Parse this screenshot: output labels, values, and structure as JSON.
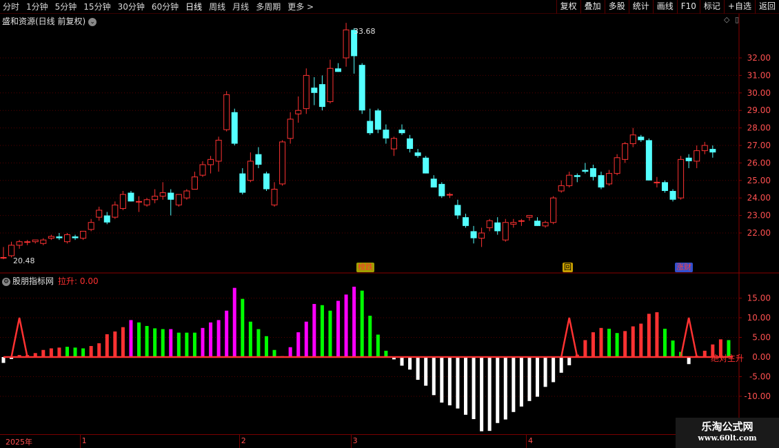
{
  "toolbar": {
    "periods": [
      "分时",
      "1分钟",
      "5分钟",
      "15分钟",
      "30分钟",
      "60分钟",
      "日线",
      "周线",
      "月线",
      "多周期",
      "更多 >"
    ],
    "active_period": "日线",
    "buttons": [
      "复权",
      "叠加",
      "多股",
      "统计",
      "画线",
      "F10",
      "标记",
      "+自选",
      "返回"
    ]
  },
  "stock": {
    "title": "盛和资源(日线 前复权)",
    "high_label": "33.68",
    "low_label": "20.48"
  },
  "indicator": {
    "name": "股朋指标网",
    "value_label": "拉升: 0.00",
    "absolute_label": "绝对主升"
  },
  "badges": {
    "bangdie": "榜跌",
    "hui": "回",
    "zhangcai": "涨财"
  },
  "price_axis": [
    "32.00",
    "31.00",
    "30.00",
    "29.00",
    "28.00",
    "27.00",
    "26.00",
    "25.00",
    "24.00",
    "23.00",
    "22.00"
  ],
  "indicator_axis": [
    "15.00",
    "10.00",
    "5.00",
    "0.00",
    "-5.00",
    "-10.00"
  ],
  "date_axis": [
    "2025年",
    "1",
    "2",
    "3",
    "4"
  ],
  "watermark": {
    "line1": "乐淘公式网",
    "line2": "www.60lt.com"
  },
  "colors": {
    "up": "#ff3232",
    "down": "#54ffff",
    "bg": "#000000",
    "grid": "#5a0000",
    "pink": "#ff00ff",
    "green": "#00ff00",
    "white": "#ffffff"
  },
  "chart_data": {
    "type": "candlestick",
    "title": "盛和资源(日线 前复权)",
    "ylim": [
      21.0,
      33.8
    ],
    "candles": [
      {
        "o": 20.6,
        "h": 21.2,
        "l": 20.5,
        "c": 20.6
      },
      {
        "o": 20.7,
        "h": 21.5,
        "l": 20.6,
        "c": 21.3
      },
      {
        "o": 21.3,
        "h": 21.6,
        "l": 21.1,
        "c": 21.5
      },
      {
        "o": 21.5,
        "h": 21.6,
        "l": 21.3,
        "c": 21.5
      },
      {
        "o": 21.5,
        "h": 21.6,
        "l": 21.4,
        "c": 21.6
      },
      {
        "o": 21.4,
        "h": 21.7,
        "l": 21.3,
        "c": 21.6
      },
      {
        "o": 21.7,
        "h": 21.9,
        "l": 21.6,
        "c": 21.8
      },
      {
        "o": 21.8,
        "h": 22.0,
        "l": 21.6,
        "c": 21.7
      },
      {
        "o": 21.5,
        "h": 22.0,
        "l": 21.4,
        "c": 21.9
      },
      {
        "o": 21.8,
        "h": 21.9,
        "l": 21.6,
        "c": 21.7
      },
      {
        "o": 21.7,
        "h": 22.1,
        "l": 21.6,
        "c": 22.1
      },
      {
        "o": 22.2,
        "h": 22.8,
        "l": 22.1,
        "c": 22.6
      },
      {
        "o": 22.9,
        "h": 23.5,
        "l": 22.7,
        "c": 23.3
      },
      {
        "o": 23.0,
        "h": 23.2,
        "l": 22.5,
        "c": 22.6
      },
      {
        "o": 22.9,
        "h": 23.8,
        "l": 22.8,
        "c": 23.6
      },
      {
        "o": 23.4,
        "h": 24.4,
        "l": 23.3,
        "c": 24.2
      },
      {
        "o": 24.3,
        "h": 24.4,
        "l": 23.8,
        "c": 23.8
      },
      {
        "o": 23.8,
        "h": 24.1,
        "l": 23.2,
        "c": 23.8
      },
      {
        "o": 23.6,
        "h": 24.0,
        "l": 23.5,
        "c": 23.9
      },
      {
        "o": 23.9,
        "h": 24.5,
        "l": 23.7,
        "c": 24.1
      },
      {
        "o": 24.1,
        "h": 24.9,
        "l": 23.9,
        "c": 24.3
      },
      {
        "o": 24.3,
        "h": 24.5,
        "l": 23.0,
        "c": 23.9
      },
      {
        "o": 23.6,
        "h": 24.2,
        "l": 23.5,
        "c": 24.2
      },
      {
        "o": 24.0,
        "h": 24.5,
        "l": 23.9,
        "c": 24.4
      },
      {
        "o": 24.5,
        "h": 25.5,
        "l": 24.5,
        "c": 25.2
      },
      {
        "o": 25.3,
        "h": 26.1,
        "l": 25.2,
        "c": 25.9
      },
      {
        "o": 25.9,
        "h": 26.4,
        "l": 25.4,
        "c": 26.2
      },
      {
        "o": 26.1,
        "h": 27.5,
        "l": 25.5,
        "c": 27.3
      },
      {
        "o": 27.9,
        "h": 30.1,
        "l": 27.8,
        "c": 29.9
      },
      {
        "o": 28.9,
        "h": 29.1,
        "l": 27.0,
        "c": 27.1
      },
      {
        "o": 25.4,
        "h": 25.7,
        "l": 24.2,
        "c": 24.3
      },
      {
        "o": 25.0,
        "h": 26.6,
        "l": 24.9,
        "c": 26.1
      },
      {
        "o": 26.5,
        "h": 26.9,
        "l": 25.7,
        "c": 25.9
      },
      {
        "o": 25.4,
        "h": 25.5,
        "l": 24.4,
        "c": 24.5
      },
      {
        "o": 23.6,
        "h": 24.9,
        "l": 23.5,
        "c": 24.5
      },
      {
        "o": 24.8,
        "h": 27.3,
        "l": 24.7,
        "c": 27.2
      },
      {
        "o": 27.4,
        "h": 28.9,
        "l": 27.1,
        "c": 28.5
      },
      {
        "o": 28.8,
        "h": 29.8,
        "l": 28.3,
        "c": 29.0
      },
      {
        "o": 29.1,
        "h": 31.4,
        "l": 28.8,
        "c": 31.0
      },
      {
        "o": 30.3,
        "h": 30.9,
        "l": 29.3,
        "c": 30.0
      },
      {
        "o": 30.5,
        "h": 31.0,
        "l": 29.0,
        "c": 29.2
      },
      {
        "o": 29.5,
        "h": 31.9,
        "l": 29.4,
        "c": 31.4
      },
      {
        "o": 31.4,
        "h": 31.7,
        "l": 31.2,
        "c": 31.2
      },
      {
        "o": 32.0,
        "h": 34.0,
        "l": 31.5,
        "c": 33.6
      },
      {
        "o": 33.6,
        "h": 33.7,
        "l": 31.1,
        "c": 32.1
      },
      {
        "o": 31.6,
        "h": 31.7,
        "l": 28.8,
        "c": 29.0
      },
      {
        "o": 28.4,
        "h": 29.1,
        "l": 27.6,
        "c": 27.7
      },
      {
        "o": 29.0,
        "h": 29.1,
        "l": 27.7,
        "c": 27.9
      },
      {
        "o": 27.9,
        "h": 28.2,
        "l": 27.1,
        "c": 27.4
      },
      {
        "o": 26.8,
        "h": 27.5,
        "l": 26.4,
        "c": 27.4
      },
      {
        "o": 27.9,
        "h": 28.2,
        "l": 27.6,
        "c": 27.7
      },
      {
        "o": 27.4,
        "h": 27.6,
        "l": 26.6,
        "c": 26.8
      },
      {
        "o": 26.6,
        "h": 26.8,
        "l": 26.3,
        "c": 26.4
      },
      {
        "o": 26.3,
        "h": 26.4,
        "l": 25.4,
        "c": 25.4
      },
      {
        "o": 25.1,
        "h": 25.3,
        "l": 24.6,
        "c": 24.6
      },
      {
        "o": 24.8,
        "h": 24.9,
        "l": 24.0,
        "c": 24.1
      },
      {
        "o": 24.2,
        "h": 24.3,
        "l": 24.0,
        "c": 24.2
      },
      {
        "o": 23.6,
        "h": 23.9,
        "l": 22.8,
        "c": 23.0
      },
      {
        "o": 22.9,
        "h": 23.1,
        "l": 22.3,
        "c": 22.4
      },
      {
        "o": 22.1,
        "h": 22.4,
        "l": 21.4,
        "c": 21.7
      },
      {
        "o": 21.7,
        "h": 22.3,
        "l": 21.2,
        "c": 22.0
      },
      {
        "o": 22.3,
        "h": 22.8,
        "l": 22.1,
        "c": 22.7
      },
      {
        "o": 22.6,
        "h": 22.9,
        "l": 21.9,
        "c": 22.1
      },
      {
        "o": 21.6,
        "h": 22.8,
        "l": 21.5,
        "c": 22.6
      },
      {
        "o": 22.5,
        "h": 22.8,
        "l": 22.3,
        "c": 22.6
      },
      {
        "o": 22.7,
        "h": 22.8,
        "l": 22.4,
        "c": 22.7
      },
      {
        "o": 22.9,
        "h": 23.0,
        "l": 22.7,
        "c": 23.0
      },
      {
        "o": 22.7,
        "h": 22.9,
        "l": 22.4,
        "c": 22.4
      },
      {
        "o": 22.4,
        "h": 22.7,
        "l": 22.3,
        "c": 22.6
      },
      {
        "o": 22.6,
        "h": 24.1,
        "l": 22.5,
        "c": 24.0
      },
      {
        "o": 24.4,
        "h": 25.0,
        "l": 24.3,
        "c": 24.7
      },
      {
        "o": 24.7,
        "h": 25.5,
        "l": 24.6,
        "c": 25.3
      },
      {
        "o": 25.3,
        "h": 25.4,
        "l": 24.9,
        "c": 25.2
      },
      {
        "o": 25.6,
        "h": 26.0,
        "l": 25.4,
        "c": 25.5
      },
      {
        "o": 25.7,
        "h": 25.9,
        "l": 25.0,
        "c": 25.2
      },
      {
        "o": 25.3,
        "h": 25.5,
        "l": 24.5,
        "c": 24.6
      },
      {
        "o": 24.8,
        "h": 25.6,
        "l": 24.7,
        "c": 25.4
      },
      {
        "o": 25.4,
        "h": 26.5,
        "l": 25.3,
        "c": 26.3
      },
      {
        "o": 26.2,
        "h": 27.2,
        "l": 26.0,
        "c": 27.1
      },
      {
        "o": 27.1,
        "h": 28.0,
        "l": 26.9,
        "c": 27.6
      },
      {
        "o": 27.5,
        "h": 27.6,
        "l": 27.2,
        "c": 27.3
      },
      {
        "o": 27.3,
        "h": 27.4,
        "l": 25.0,
        "c": 25.0
      },
      {
        "o": 24.9,
        "h": 25.2,
        "l": 24.6,
        "c": 24.9
      },
      {
        "o": 24.9,
        "h": 25.0,
        "l": 24.3,
        "c": 24.4
      },
      {
        "o": 24.4,
        "h": 24.5,
        "l": 23.8,
        "c": 23.9
      },
      {
        "o": 24.0,
        "h": 26.4,
        "l": 23.9,
        "c": 26.2
      },
      {
        "o": 26.3,
        "h": 26.5,
        "l": 25.7,
        "c": 26.1
      },
      {
        "o": 26.1,
        "h": 27.0,
        "l": 25.7,
        "c": 26.7
      },
      {
        "o": 26.7,
        "h": 27.2,
        "l": 26.5,
        "c": 27.0
      },
      {
        "o": 26.8,
        "h": 27.0,
        "l": 26.3,
        "c": 26.6
      }
    ],
    "indicator": {
      "ylim": [
        -12.5,
        20.5
      ],
      "bars": [
        {
          "v": -1.5,
          "c": "white"
        },
        {
          "v": -0.5,
          "c": "white"
        },
        {
          "v": 0.5,
          "c": "red"
        },
        {
          "v": 0.5,
          "c": "red"
        },
        {
          "v": 1,
          "c": "red"
        },
        {
          "v": 1.8,
          "c": "red"
        },
        {
          "v": 2.2,
          "c": "red"
        },
        {
          "v": 2.4,
          "c": "red"
        },
        {
          "v": 2.6,
          "c": "green"
        },
        {
          "v": 2.4,
          "c": "green"
        },
        {
          "v": 2.2,
          "c": "green"
        },
        {
          "v": 2.8,
          "c": "red"
        },
        {
          "v": 3.5,
          "c": "red"
        },
        {
          "v": 5.8,
          "c": "red"
        },
        {
          "v": 6.5,
          "c": "red"
        },
        {
          "v": 7.6,
          "c": "red"
        },
        {
          "v": 9.4,
          "c": "pink"
        },
        {
          "v": 8.8,
          "c": "green"
        },
        {
          "v": 7.9,
          "c": "green"
        },
        {
          "v": 7.3,
          "c": "green"
        },
        {
          "v": 7.1,
          "c": "green"
        },
        {
          "v": 7.1,
          "c": "pink"
        },
        {
          "v": 6.2,
          "c": "green"
        },
        {
          "v": 6.2,
          "c": "green"
        },
        {
          "v": 6.2,
          "c": "green"
        },
        {
          "v": 7.4,
          "c": "pink"
        },
        {
          "v": 8.8,
          "c": "pink"
        },
        {
          "v": 9.4,
          "c": "pink"
        },
        {
          "v": 11.8,
          "c": "pink"
        },
        {
          "v": 17.6,
          "c": "pink"
        },
        {
          "v": 14.8,
          "c": "green"
        },
        {
          "v": 9.0,
          "c": "green"
        },
        {
          "v": 7.1,
          "c": "green"
        },
        {
          "v": 5.3,
          "c": "green"
        },
        {
          "v": 1.8,
          "c": "green"
        },
        {
          "v": 0.2,
          "c": "white"
        },
        {
          "v": 2.5,
          "c": "pink"
        },
        {
          "v": 6.3,
          "c": "pink"
        },
        {
          "v": 9.0,
          "c": "pink"
        },
        {
          "v": 13.5,
          "c": "pink"
        },
        {
          "v": 13.2,
          "c": "green"
        },
        {
          "v": 11.8,
          "c": "green"
        },
        {
          "v": 14.3,
          "c": "pink"
        },
        {
          "v": 15.9,
          "c": "pink"
        },
        {
          "v": 17.9,
          "c": "pink"
        },
        {
          "v": 16.9,
          "c": "green"
        },
        {
          "v": 10.5,
          "c": "green"
        },
        {
          "v": 5.7,
          "c": "green"
        },
        {
          "v": 1.6,
          "c": "green"
        },
        {
          "v": -0.6,
          "c": "white"
        },
        {
          "v": -2.2,
          "c": "white"
        },
        {
          "v": -3.2,
          "c": "white"
        },
        {
          "v": -5.8,
          "c": "white"
        },
        {
          "v": -7.3,
          "c": "white"
        },
        {
          "v": -9.7,
          "c": "white"
        },
        {
          "v": -11.6,
          "c": "white"
        },
        {
          "v": -12.3,
          "c": "white"
        },
        {
          "v": -13.1,
          "c": "white"
        },
        {
          "v": -14.7,
          "c": "white"
        },
        {
          "v": -15.8,
          "c": "white"
        },
        {
          "v": -18.9,
          "c": "white"
        },
        {
          "v": -18.8,
          "c": "white"
        },
        {
          "v": -16.8,
          "c": "white"
        },
        {
          "v": -15.9,
          "c": "white"
        },
        {
          "v": -14.0,
          "c": "white"
        },
        {
          "v": -12.6,
          "c": "white"
        },
        {
          "v": -11.2,
          "c": "white"
        },
        {
          "v": -10.1,
          "c": "white"
        },
        {
          "v": -7.6,
          "c": "white"
        },
        {
          "v": -6.4,
          "c": "white"
        },
        {
          "v": -4.0,
          "c": "white"
        },
        {
          "v": -2.1,
          "c": "white"
        },
        {
          "v": 0.6,
          "c": "red"
        },
        {
          "v": 4.3,
          "c": "red"
        },
        {
          "v": 6.3,
          "c": "red"
        },
        {
          "v": 7.4,
          "c": "red"
        },
        {
          "v": 7.2,
          "c": "green"
        },
        {
          "v": 6.1,
          "c": "green"
        },
        {
          "v": 6.6,
          "c": "red"
        },
        {
          "v": 7.8,
          "c": "red"
        },
        {
          "v": 8.5,
          "c": "red"
        },
        {
          "v": 11.0,
          "c": "red"
        },
        {
          "v": 11.4,
          "c": "red"
        },
        {
          "v": 7.2,
          "c": "green"
        },
        {
          "v": 4.2,
          "c": "green"
        },
        {
          "v": 1.3,
          "c": "green"
        },
        {
          "v": -1.8,
          "c": "white"
        },
        {
          "v": 0.3,
          "c": "red"
        },
        {
          "v": 1.6,
          "c": "red"
        },
        {
          "v": 3.2,
          "c": "red"
        },
        {
          "v": 4.5,
          "c": "red"
        },
        {
          "v": 4.3,
          "c": "green"
        }
      ],
      "spikes": [
        2,
        71,
        86
      ],
      "spike_value": 10
    }
  }
}
